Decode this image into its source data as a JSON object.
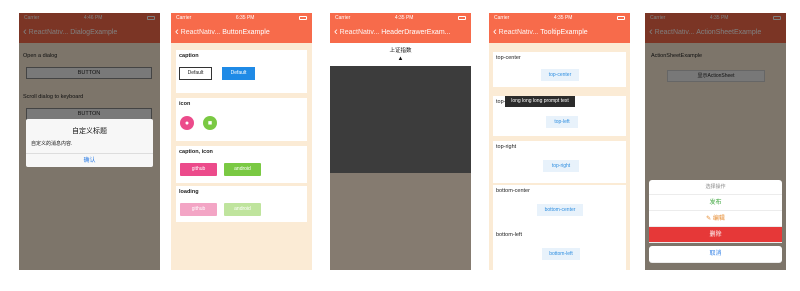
{
  "status": {
    "carrier": "Carrier",
    "times": [
      "4:46 PM",
      "6:35 PM",
      "4:35 PM",
      "4:35 PM",
      "4:35 PM"
    ]
  },
  "dialog": {
    "nav_back": "ReactNativ...",
    "nav_title": "DialogExample",
    "open_label": "Open a dialog",
    "open_button": "BUTTON",
    "scroll_label": "Scroll dialog to keyboard",
    "scroll_button": "BUTTON",
    "alert_title": "自定义标题",
    "alert_message": "自定义的消息内容.",
    "alert_ok": "确认"
  },
  "button": {
    "nav_back": "ReactNativ...",
    "nav_title": "ButtonExample",
    "caption_title": "caption",
    "default_outline": "Default",
    "default_filled": "Default",
    "icon_title": "icon",
    "caption_icon_title": "caption, icon",
    "github": "github",
    "android": "android",
    "loading_title": "loading",
    "loading_github": "github",
    "loading_android": "android",
    "colors": {
      "github": "#ec4b8b",
      "android": "#7ac943",
      "blue": "#1f8ae6"
    }
  },
  "drawer": {
    "nav_back": "ReactNativ...",
    "nav_title": "HeaderDrawerExam...",
    "drawer_text": "上证指数",
    "arrow": "▲"
  },
  "tooltip": {
    "nav_back": "ReactNativ...",
    "nav_title": "TooltipExample",
    "tooltip_text": "long long long prompt text",
    "cards": [
      {
        "title": "top-center",
        "button": "top-center"
      },
      {
        "title": "top-left",
        "button": "top-left"
      },
      {
        "title": "top-right",
        "button": "top-right"
      },
      {
        "title": "bottom-center",
        "button": "bottom-center"
      },
      {
        "title": "bottom-left",
        "button": "bottom-left"
      }
    ]
  },
  "actionsheet": {
    "nav_back": "ReactNativ...",
    "nav_title": "ActionSheetExample",
    "section_label": "ActionSheetExample",
    "show_button": "显示ActionSheet",
    "sheet_title": "选择操作",
    "publish": "发布",
    "edit": "编辑",
    "delete": "删除",
    "cancel": "取消"
  }
}
